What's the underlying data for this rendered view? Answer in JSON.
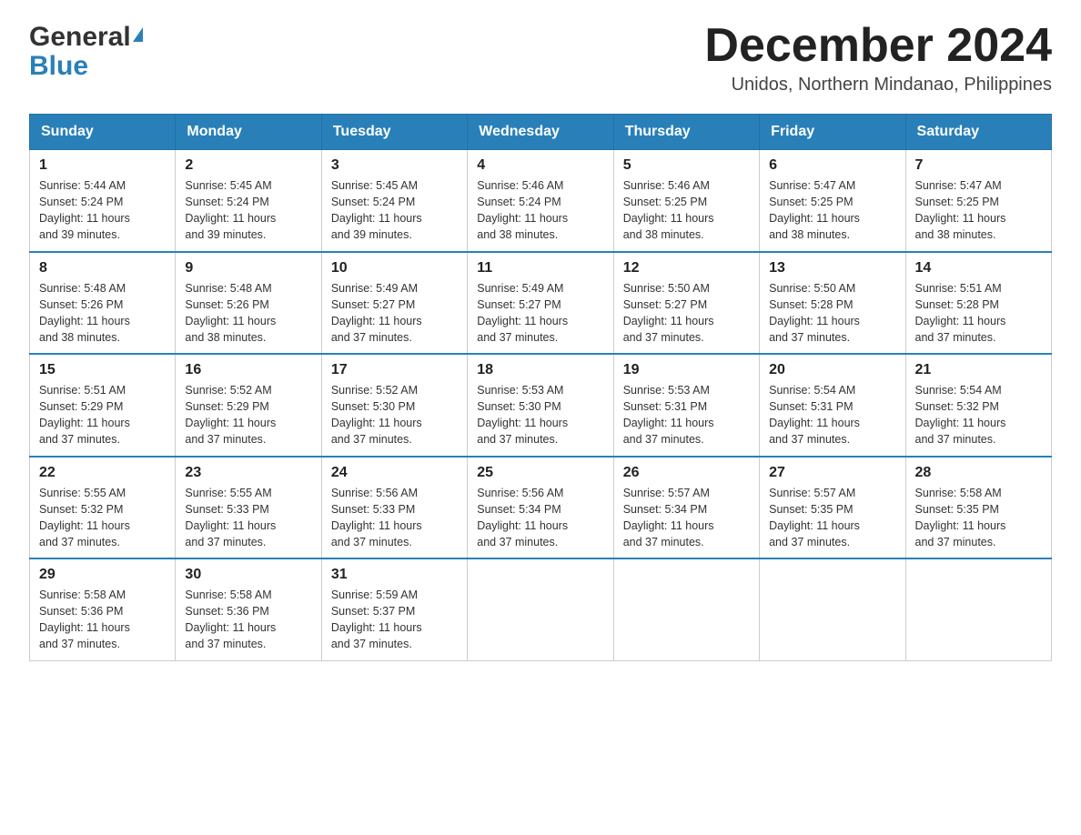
{
  "header": {
    "logo": {
      "general_text": "General",
      "blue_text": "Blue"
    },
    "title": "December 2024",
    "location": "Unidos, Northern Mindanao, Philippines"
  },
  "calendar": {
    "days_of_week": [
      "Sunday",
      "Monday",
      "Tuesday",
      "Wednesday",
      "Thursday",
      "Friday",
      "Saturday"
    ],
    "weeks": [
      [
        {
          "day": "1",
          "sunrise": "5:44 AM",
          "sunset": "5:24 PM",
          "daylight": "11 hours and 39 minutes."
        },
        {
          "day": "2",
          "sunrise": "5:45 AM",
          "sunset": "5:24 PM",
          "daylight": "11 hours and 39 minutes."
        },
        {
          "day": "3",
          "sunrise": "5:45 AM",
          "sunset": "5:24 PM",
          "daylight": "11 hours and 39 minutes."
        },
        {
          "day": "4",
          "sunrise": "5:46 AM",
          "sunset": "5:24 PM",
          "daylight": "11 hours and 38 minutes."
        },
        {
          "day": "5",
          "sunrise": "5:46 AM",
          "sunset": "5:25 PM",
          "daylight": "11 hours and 38 minutes."
        },
        {
          "day": "6",
          "sunrise": "5:47 AM",
          "sunset": "5:25 PM",
          "daylight": "11 hours and 38 minutes."
        },
        {
          "day": "7",
          "sunrise": "5:47 AM",
          "sunset": "5:25 PM",
          "daylight": "11 hours and 38 minutes."
        }
      ],
      [
        {
          "day": "8",
          "sunrise": "5:48 AM",
          "sunset": "5:26 PM",
          "daylight": "11 hours and 38 minutes."
        },
        {
          "day": "9",
          "sunrise": "5:48 AM",
          "sunset": "5:26 PM",
          "daylight": "11 hours and 38 minutes."
        },
        {
          "day": "10",
          "sunrise": "5:49 AM",
          "sunset": "5:27 PM",
          "daylight": "11 hours and 37 minutes."
        },
        {
          "day": "11",
          "sunrise": "5:49 AM",
          "sunset": "5:27 PM",
          "daylight": "11 hours and 37 minutes."
        },
        {
          "day": "12",
          "sunrise": "5:50 AM",
          "sunset": "5:27 PM",
          "daylight": "11 hours and 37 minutes."
        },
        {
          "day": "13",
          "sunrise": "5:50 AM",
          "sunset": "5:28 PM",
          "daylight": "11 hours and 37 minutes."
        },
        {
          "day": "14",
          "sunrise": "5:51 AM",
          "sunset": "5:28 PM",
          "daylight": "11 hours and 37 minutes."
        }
      ],
      [
        {
          "day": "15",
          "sunrise": "5:51 AM",
          "sunset": "5:29 PM",
          "daylight": "11 hours and 37 minutes."
        },
        {
          "day": "16",
          "sunrise": "5:52 AM",
          "sunset": "5:29 PM",
          "daylight": "11 hours and 37 minutes."
        },
        {
          "day": "17",
          "sunrise": "5:52 AM",
          "sunset": "5:30 PM",
          "daylight": "11 hours and 37 minutes."
        },
        {
          "day": "18",
          "sunrise": "5:53 AM",
          "sunset": "5:30 PM",
          "daylight": "11 hours and 37 minutes."
        },
        {
          "day": "19",
          "sunrise": "5:53 AM",
          "sunset": "5:31 PM",
          "daylight": "11 hours and 37 minutes."
        },
        {
          "day": "20",
          "sunrise": "5:54 AM",
          "sunset": "5:31 PM",
          "daylight": "11 hours and 37 minutes."
        },
        {
          "day": "21",
          "sunrise": "5:54 AM",
          "sunset": "5:32 PM",
          "daylight": "11 hours and 37 minutes."
        }
      ],
      [
        {
          "day": "22",
          "sunrise": "5:55 AM",
          "sunset": "5:32 PM",
          "daylight": "11 hours and 37 minutes."
        },
        {
          "day": "23",
          "sunrise": "5:55 AM",
          "sunset": "5:33 PM",
          "daylight": "11 hours and 37 minutes."
        },
        {
          "day": "24",
          "sunrise": "5:56 AM",
          "sunset": "5:33 PM",
          "daylight": "11 hours and 37 minutes."
        },
        {
          "day": "25",
          "sunrise": "5:56 AM",
          "sunset": "5:34 PM",
          "daylight": "11 hours and 37 minutes."
        },
        {
          "day": "26",
          "sunrise": "5:57 AM",
          "sunset": "5:34 PM",
          "daylight": "11 hours and 37 minutes."
        },
        {
          "day": "27",
          "sunrise": "5:57 AM",
          "sunset": "5:35 PM",
          "daylight": "11 hours and 37 minutes."
        },
        {
          "day": "28",
          "sunrise": "5:58 AM",
          "sunset": "5:35 PM",
          "daylight": "11 hours and 37 minutes."
        }
      ],
      [
        {
          "day": "29",
          "sunrise": "5:58 AM",
          "sunset": "5:36 PM",
          "daylight": "11 hours and 37 minutes."
        },
        {
          "day": "30",
          "sunrise": "5:58 AM",
          "sunset": "5:36 PM",
          "daylight": "11 hours and 37 minutes."
        },
        {
          "day": "31",
          "sunrise": "5:59 AM",
          "sunset": "5:37 PM",
          "daylight": "11 hours and 37 minutes."
        },
        null,
        null,
        null,
        null
      ]
    ],
    "labels": {
      "sunrise": "Sunrise:",
      "sunset": "Sunset:",
      "daylight": "Daylight:"
    }
  }
}
